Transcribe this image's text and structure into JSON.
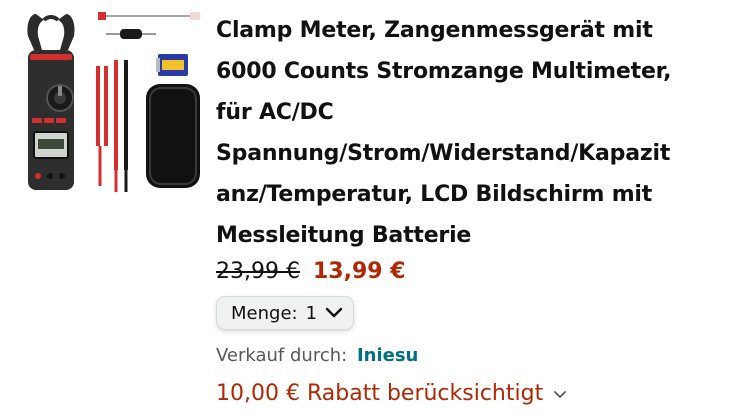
{
  "product": {
    "image_alt": "Clamp meter with test leads, batteries and carrying case",
    "title_lines": [
      "Clamp Meter, Zangenmessgerät mit",
      "6000 Counts Stromzange Multimeter,",
      "für AC/DC",
      "Spannung/Strom/Widerstand/Kapazit",
      "anz/Temperatur, LCD Bildschirm mit",
      "Messleitung Batterie"
    ],
    "old_price": "23,99 €",
    "new_price": "13,99 €",
    "quantity": {
      "label": "Menge:",
      "value": "1"
    },
    "seller": {
      "label": "Verkauf durch:",
      "name": "Iniesu"
    },
    "discount": {
      "text": "10,00 € Rabatt berücksichtigt"
    }
  },
  "colors": {
    "price_red": "#b12704",
    "link_teal": "#007185",
    "muted_gray": "#565959"
  },
  "icons": [
    "chevron-down-icon",
    "chevron-down-small-icon"
  ]
}
